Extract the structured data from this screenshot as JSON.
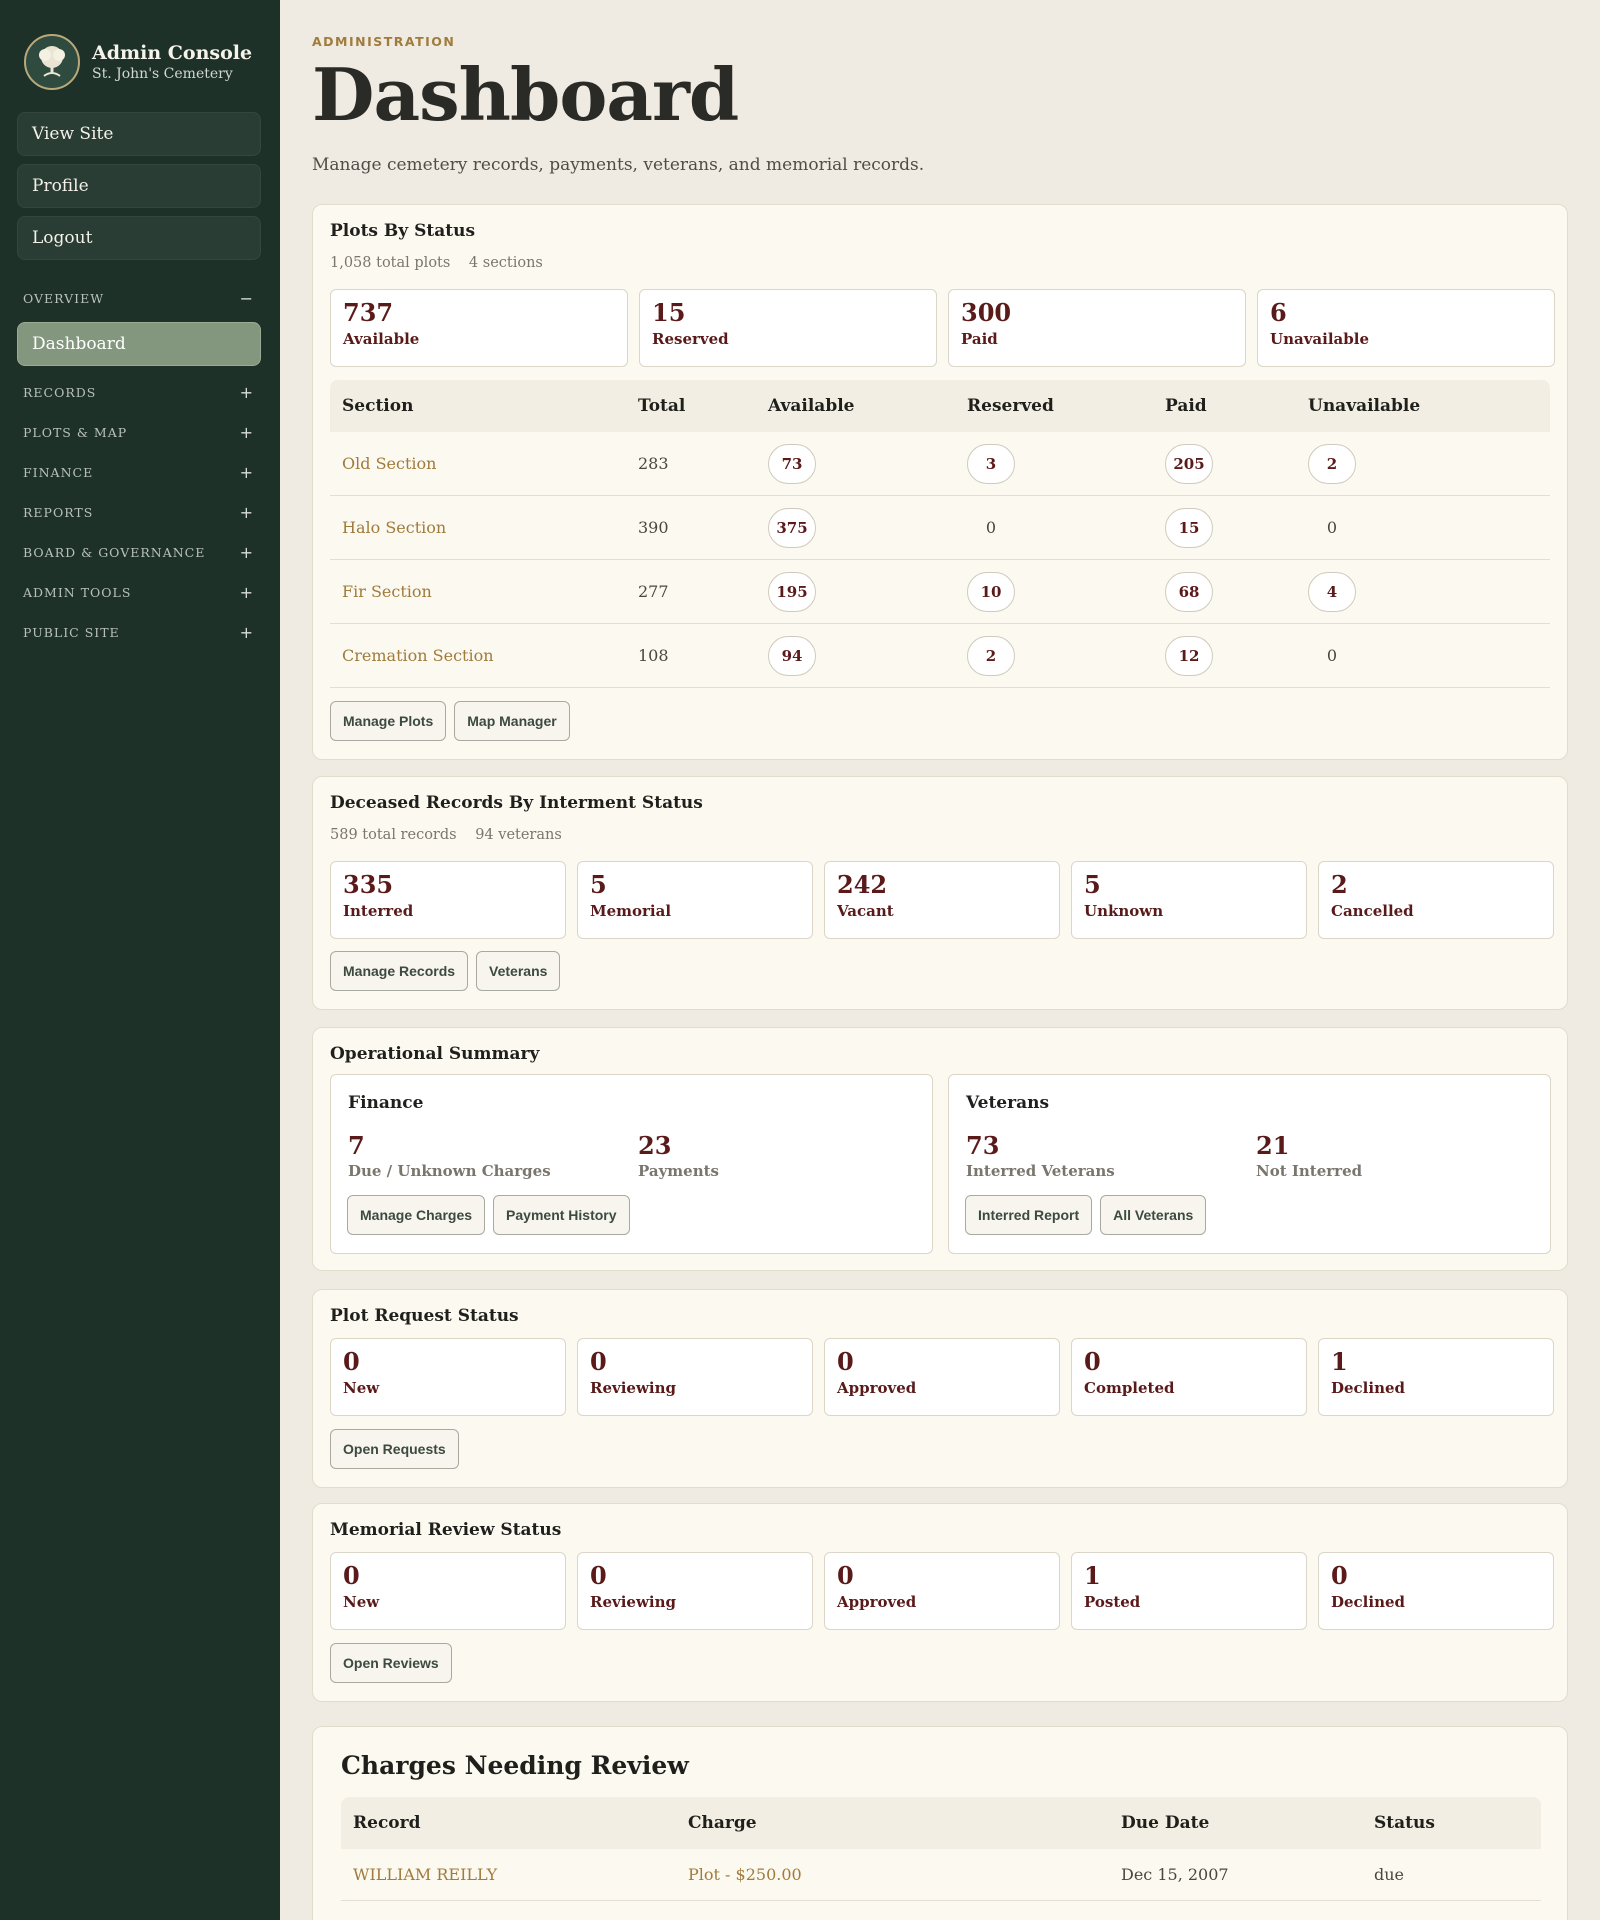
{
  "sidebar": {
    "title": "Admin Console",
    "subtitle": "St. John's Cemetery",
    "links": [
      "View Site",
      "Profile",
      "Logout"
    ],
    "overview_label": "OVERVIEW",
    "overview_toggle": "−",
    "active_item": "Dashboard",
    "sections": [
      {
        "label": "RECORDS",
        "toggle": "+"
      },
      {
        "label": "PLOTS & MAP",
        "toggle": "+"
      },
      {
        "label": "FINANCE",
        "toggle": "+"
      },
      {
        "label": "REPORTS",
        "toggle": "+"
      },
      {
        "label": "BOARD & GOVERNANCE",
        "toggle": "+"
      },
      {
        "label": "ADMIN TOOLS",
        "toggle": "+"
      },
      {
        "label": "PUBLIC SITE",
        "toggle": "+"
      }
    ]
  },
  "header": {
    "eyebrow": "ADMINISTRATION",
    "title": "Dashboard",
    "subtitle": "Manage cemetery records, payments, veterans, and memorial records."
  },
  "plots": {
    "title": "Plots By Status",
    "meta_total": "1,058 total plots",
    "meta_sections": "4 sections",
    "stats": [
      {
        "num": "737",
        "label": "Available"
      },
      {
        "num": "15",
        "label": "Reserved"
      },
      {
        "num": "300",
        "label": "Paid"
      },
      {
        "num": "6",
        "label": "Unavailable"
      }
    ],
    "columns": [
      "Section",
      "Total",
      "Available",
      "Reserved",
      "Paid",
      "Unavailable"
    ],
    "rows": [
      {
        "section": "Old Section",
        "total": "283",
        "available": "73",
        "reserved": "3",
        "paid": "205",
        "unavailable": "2"
      },
      {
        "section": "Halo Section",
        "total": "390",
        "available": "375",
        "reserved": "0",
        "paid": "15",
        "unavailable": "0"
      },
      {
        "section": "Fir Section",
        "total": "277",
        "available": "195",
        "reserved": "10",
        "paid": "68",
        "unavailable": "4"
      },
      {
        "section": "Cremation Section",
        "total": "108",
        "available": "94",
        "reserved": "2",
        "paid": "12",
        "unavailable": "0"
      }
    ],
    "buttons": [
      "Manage Plots",
      "Map Manager"
    ]
  },
  "deceased": {
    "title": "Deceased Records By Interment Status",
    "meta_total": "589 total records",
    "meta_veterans": "94 veterans",
    "stats": [
      {
        "num": "335",
        "label": "Interred"
      },
      {
        "num": "5",
        "label": "Memorial"
      },
      {
        "num": "242",
        "label": "Vacant"
      },
      {
        "num": "5",
        "label": "Unknown"
      },
      {
        "num": "2",
        "label": "Cancelled"
      }
    ],
    "buttons": [
      "Manage Records",
      "Veterans"
    ]
  },
  "operational": {
    "title": "Operational Summary",
    "finance": {
      "title": "Finance",
      "stat1_num": "7",
      "stat1_label": "Due / Unknown Charges",
      "stat2_num": "23",
      "stat2_label": "Payments",
      "buttons": [
        "Manage Charges",
        "Payment History"
      ]
    },
    "veterans": {
      "title": "Veterans",
      "stat1_num": "73",
      "stat1_label": "Interred Veterans",
      "stat2_num": "21",
      "stat2_label": "Not Interred",
      "buttons": [
        "Interred Report",
        "All Veterans"
      ]
    }
  },
  "plot_requests": {
    "title": "Plot Request Status",
    "stats": [
      {
        "num": "0",
        "label": "New"
      },
      {
        "num": "0",
        "label": "Reviewing"
      },
      {
        "num": "0",
        "label": "Approved"
      },
      {
        "num": "0",
        "label": "Completed"
      },
      {
        "num": "1",
        "label": "Declined"
      }
    ],
    "buttons": [
      "Open Requests"
    ]
  },
  "memorial_review": {
    "title": "Memorial Review Status",
    "stats": [
      {
        "num": "0",
        "label": "New"
      },
      {
        "num": "0",
        "label": "Reviewing"
      },
      {
        "num": "0",
        "label": "Approved"
      },
      {
        "num": "1",
        "label": "Posted"
      },
      {
        "num": "0",
        "label": "Declined"
      }
    ],
    "buttons": [
      "Open Reviews"
    ]
  },
  "charges": {
    "title": "Charges Needing Review",
    "columns": [
      "Record",
      "Charge",
      "Due Date",
      "Status"
    ],
    "rows": [
      {
        "record": "WILLIAM REILLY",
        "charge": "Plot - $250.00",
        "due_date": "Dec 15, 2007",
        "status": "due"
      }
    ]
  },
  "colors": {
    "sidebar_bg": "#1e3129",
    "accent_gold": "#a07b3c",
    "stat_maroon": "#5a1a1a",
    "active_nav": "#83977f",
    "page_bg": "#efebe2"
  }
}
